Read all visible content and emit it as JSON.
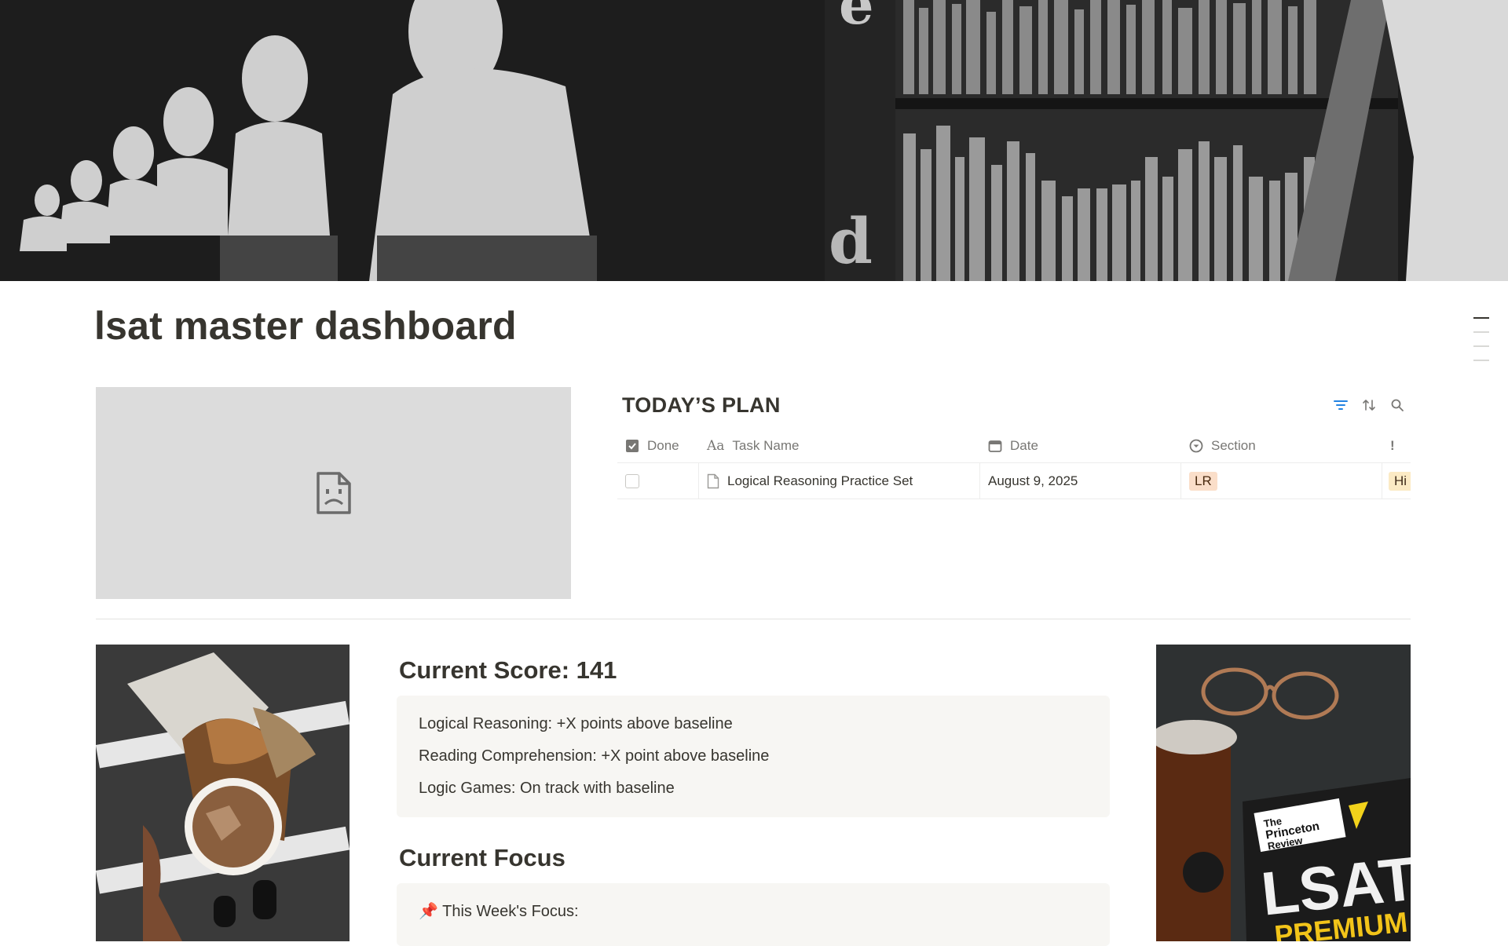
{
  "page": {
    "title": "lsat master dashboard"
  },
  "plan": {
    "title": "TODAY’S PLAN",
    "columns": {
      "done": "Done",
      "task_name": "Task Name",
      "date": "Date",
      "section": "Section",
      "priority_icon": "!"
    },
    "rows": [
      {
        "task_name": "Logical Reasoning Practice Set",
        "date": "August 9, 2025",
        "section": "LR",
        "priority": "Hi"
      }
    ],
    "tools": [
      "filter-icon",
      "sort-icon",
      "search-icon"
    ],
    "accent": "#2383e2"
  },
  "score": {
    "heading": "Current Score: 141",
    "items": [
      "Logical Reasoning: +X points above baseline",
      "Reading Comprehension: +X point above baseline",
      "Logic Games: On track with baseline"
    ]
  },
  "focus": {
    "heading": "Current Focus",
    "first_line": "📌 This Week's Focus:"
  },
  "photo_right": {
    "brand_line1": "The",
    "brand_line2": "Princeton",
    "brand_line3": "Review",
    "book_title": "LSAT",
    "book_sub": "PREMIUM"
  },
  "cover": {
    "letters": [
      "e",
      "d"
    ]
  }
}
